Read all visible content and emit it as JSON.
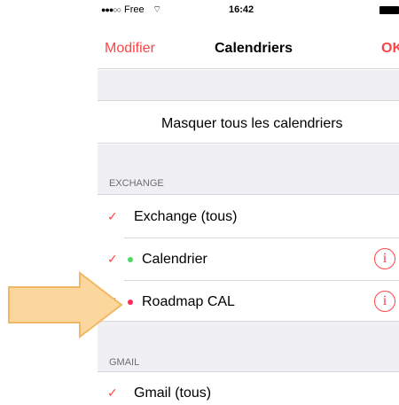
{
  "status_bar": {
    "signal": "●●●○○",
    "carrier": "Free",
    "wifi": "⌔",
    "time": "16:42"
  },
  "nav": {
    "left": "Modifier",
    "title": "Calendriers",
    "right": "OK"
  },
  "hide_all": "Masquer tous les calendriers",
  "sections": {
    "exchange": {
      "header": "EXCHANGE",
      "all": "Exchange (tous)",
      "calendars": [
        {
          "label": "Calendrier",
          "dot_color": "#4cd964"
        },
        {
          "label": "Roadmap CAL",
          "dot_color": "#ff2d55"
        }
      ]
    },
    "gmail": {
      "header": "GMAIL",
      "all": "Gmail (tous)"
    }
  },
  "icons": {
    "check": "✓",
    "info": "i"
  },
  "colors": {
    "accent": "#fd4447",
    "arrow_fill": "#fcd79d",
    "arrow_stroke": "#f1b764"
  }
}
